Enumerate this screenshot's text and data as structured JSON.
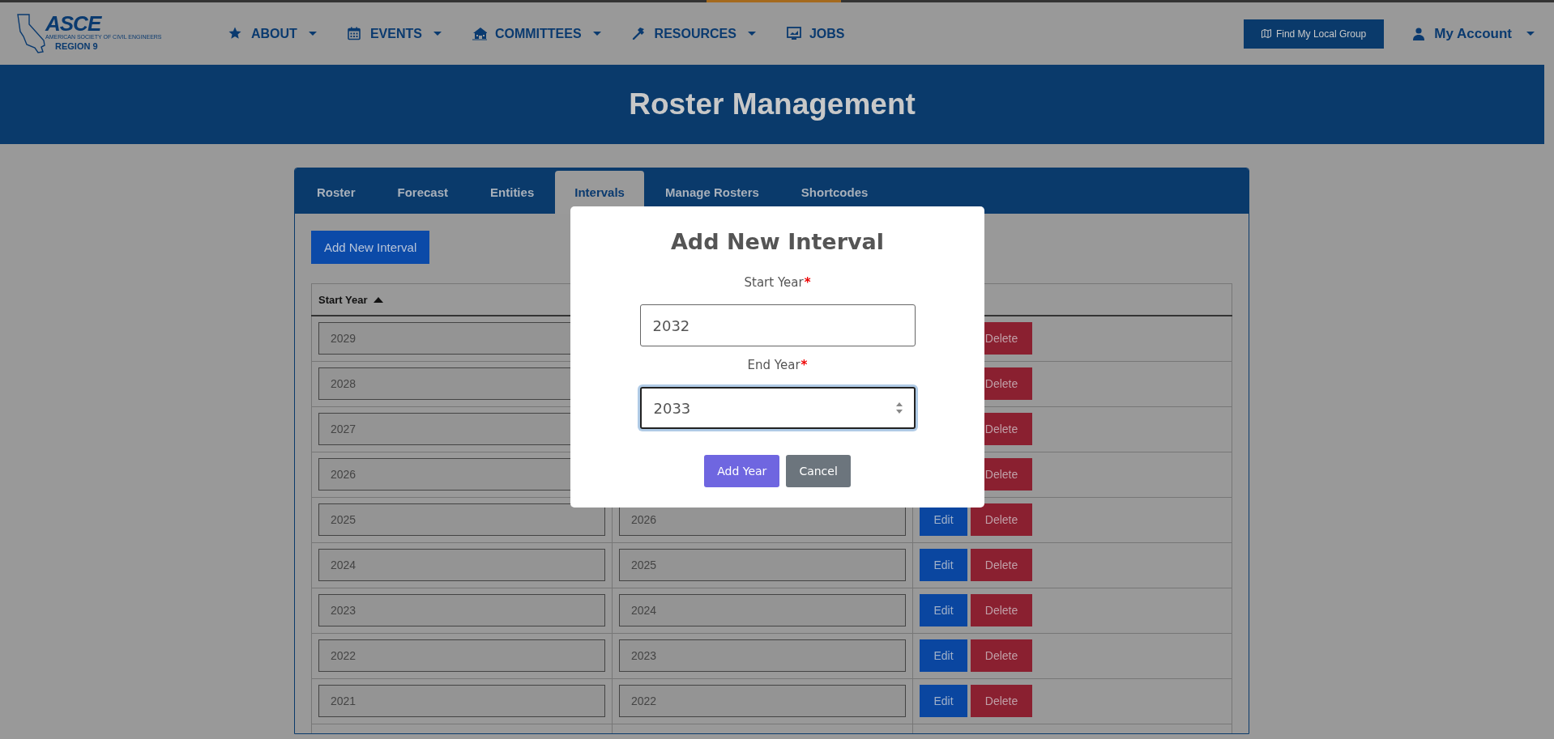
{
  "header": {
    "logo": {
      "title": "ASCE",
      "subtitle": "AMERICAN SOCIETY OF CIVIL ENGINEERS",
      "region": "REGION 9"
    },
    "nav": [
      {
        "label": "ABOUT",
        "dropdown": true
      },
      {
        "label": "EVENTS",
        "dropdown": true
      },
      {
        "label": "COMMITTEES",
        "dropdown": true
      },
      {
        "label": "RESOURCES",
        "dropdown": true
      },
      {
        "label": "JOBS",
        "dropdown": false
      }
    ],
    "find_button": "Find My Local Group",
    "account": {
      "label": "My Account",
      "dropdown": true
    }
  },
  "banner": {
    "title": "Roster Management"
  },
  "tabs": [
    {
      "label": "Roster",
      "selected": false
    },
    {
      "label": "Forecast",
      "selected": false
    },
    {
      "label": "Entities",
      "selected": false
    },
    {
      "label": "Intervals",
      "selected": true
    },
    {
      "label": "Manage Rosters",
      "selected": false
    },
    {
      "label": "Shortcodes",
      "selected": false
    }
  ],
  "add_button": "Add New Interval",
  "table": {
    "columns": [
      {
        "label": "Start Year"
      }
    ],
    "rows": [
      {
        "start": "2029",
        "delete": "Delete"
      },
      {
        "start": "2028",
        "delete": "Delete"
      },
      {
        "start": "2027",
        "delete": "Delete"
      },
      {
        "start": "2026",
        "delete": "Delete"
      },
      {
        "start": "2025",
        "end": "2026",
        "edit": "Edit",
        "delete": "Delete"
      },
      {
        "start": "2024",
        "end": "2025",
        "edit": "Edit",
        "delete": "Delete"
      },
      {
        "start": "2023",
        "end": "2024",
        "edit": "Edit",
        "delete": "Delete"
      },
      {
        "start": "2022",
        "end": "2023",
        "edit": "Edit",
        "delete": "Delete"
      },
      {
        "start": "2021",
        "end": "2022",
        "edit": "Edit",
        "delete": "Delete"
      }
    ]
  },
  "modal": {
    "title": "Add New Interval",
    "fields": [
      {
        "label": "Start Year",
        "required_mark": "*",
        "value": "2032",
        "focused": false
      },
      {
        "label": "End Year",
        "required_mark": "*",
        "value": "2033",
        "focused": true
      }
    ],
    "buttons": [
      {
        "label": "Add Year",
        "kind": "primary"
      },
      {
        "label": "Cancel",
        "kind": "secondary"
      }
    ]
  }
}
